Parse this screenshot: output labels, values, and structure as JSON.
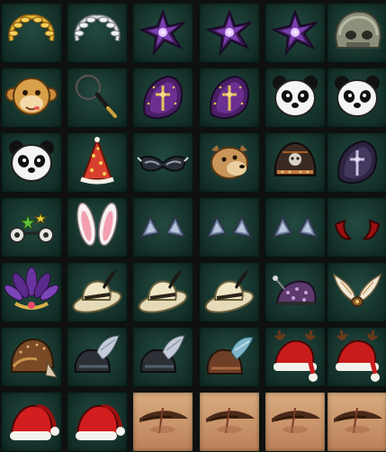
{
  "inventory": {
    "rows": [
      [
        "laurel-wreath-gold",
        "laurel-wreath-silver",
        "purple-dark-flower",
        "purple-dark-flower",
        "purple-dark-flower",
        "stone-skull-helm"
      ],
      [
        "monkey-mask",
        "whip",
        "purple-cross-shield",
        "purple-cross-shield",
        "panda-mask",
        "panda-mask"
      ],
      [
        "panda-mask",
        "party-hat",
        "dark-eye-mask",
        "bear-mask",
        "ornate-helmet",
        "dark-cross-shield"
      ],
      [
        "star-goggles",
        "bunny-ears",
        "blue-cat-ears",
        "blue-cat-ears",
        "blue-cat-ears",
        "red-horns"
      ],
      [
        "purple-feather-headdress",
        "cream-feather-hat",
        "cream-feather-hat",
        "cream-feather-hat",
        "jester-hat",
        "winged-circlet"
      ],
      [
        "leather-pilot-cap",
        "dark-plumed-helm",
        "dark-plumed-helm",
        "brown-plumed-hat",
        "antler-santa-hat",
        "antler-santa-hat"
      ],
      [
        "santa-hat",
        "santa-hat",
        "scarred-eyebrow",
        "scarred-eyebrow",
        "scarred-eyebrow",
        "scarred-eyebrow"
      ]
    ]
  }
}
